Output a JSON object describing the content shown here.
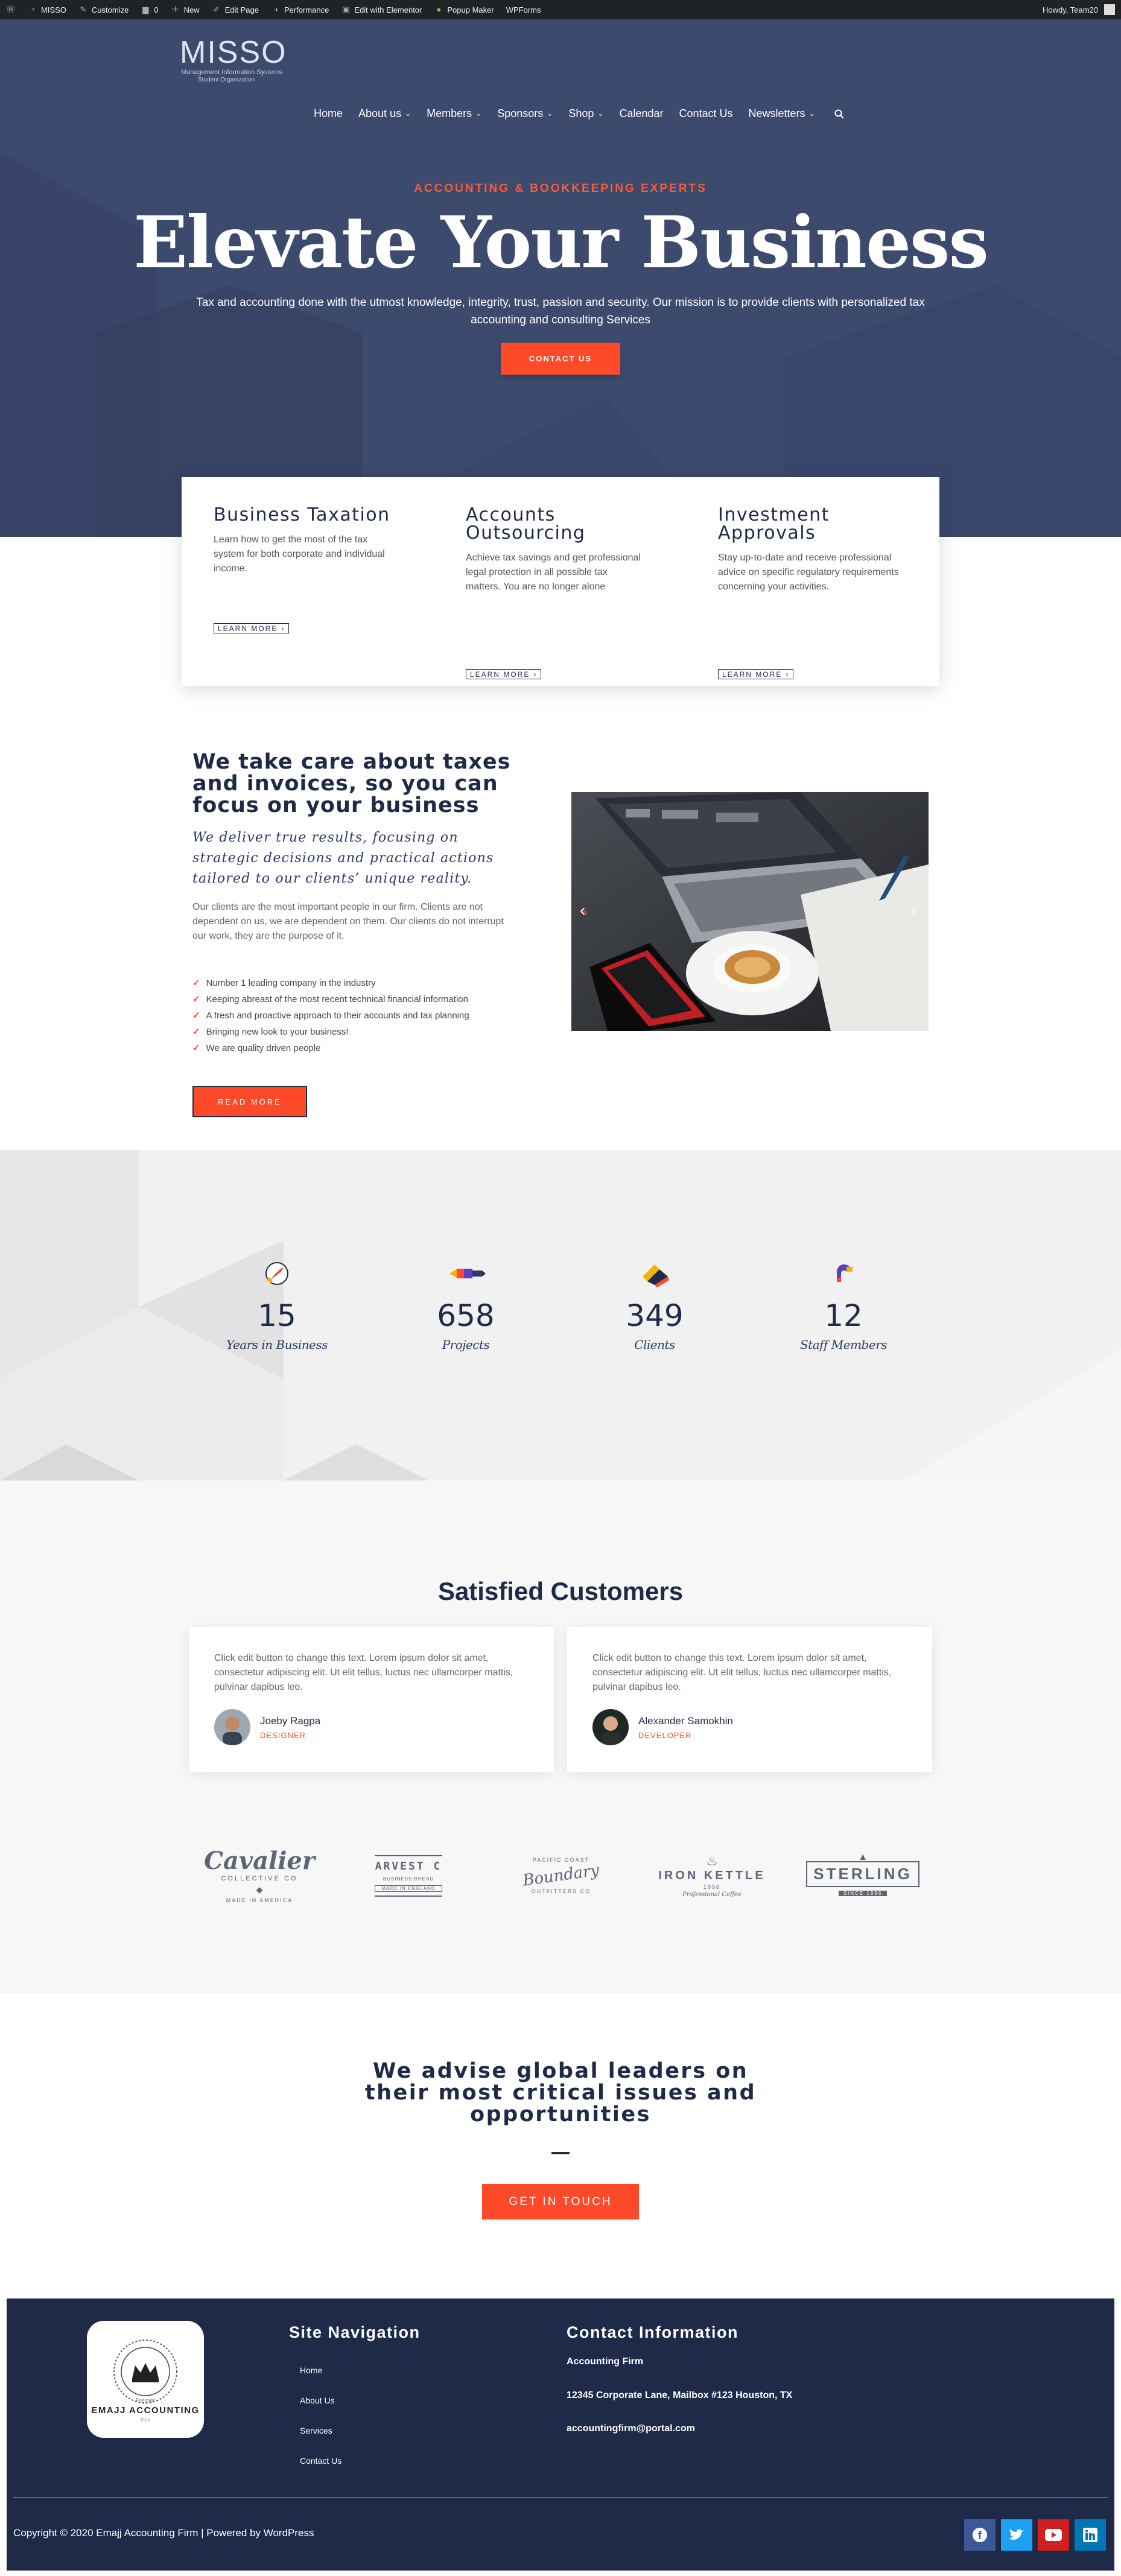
{
  "admin_bar": {
    "items": [
      "MISSO",
      "Customize",
      "0",
      "New",
      "Edit Page",
      "Performance",
      "Edit with Elementor",
      "Popup Maker",
      "WPForms"
    ],
    "howdy": "Howdy, Team20"
  },
  "site": {
    "logo_main": "MISSO",
    "logo_line1": "Management Information Systems",
    "logo_line2": "Student Organization"
  },
  "nav": {
    "items": [
      "Home",
      "About us",
      "Members",
      "Sponsors",
      "Shop",
      "Calendar",
      "Contact Us",
      "Newsletters"
    ]
  },
  "hero": {
    "kicker": "ACCOUNTING & BOOKKEEPING EXPERTS",
    "title": "Elevate Your Business",
    "subtitle": "Tax and accounting done with the utmost knowledge, integrity, trust, passion and security. Our mission is to provide clients with personalized tax accounting and consulting Services",
    "cta": "CONTACT US"
  },
  "services": [
    {
      "title": "Business Taxation",
      "text": "Learn how to get the most of the tax system for both corporate and individual income.",
      "link": "LEARN MORE"
    },
    {
      "title": "Accounts Outsourcing",
      "text": "Achieve tax savings and get professional legal protection in all possible tax matters. You are no longer alone",
      "link": "LEARN MORE"
    },
    {
      "title": "Investment Approvals",
      "text": "Stay up-to-date and receive professional advice on specific regulatory requirements concerning your activities.",
      "link": "LEARN MORE"
    }
  ],
  "about": {
    "heading": "We take care about taxes and invoices, so you can focus on your business",
    "quote": "We deliver true results, focusing on strategic decisions and practical actions tailored to our clients’ unique reality.",
    "paragraph": "Our clients are the most important people in our firm. Clients are not dependent on us, we are dependent on them. Our clients do not interrupt our work, they are the purpose of it.",
    "list": [
      "Number 1 leading company in the industry",
      "Keeping abreast of the most recent technical financial information",
      "A fresh and proactive approach to their accounts and tax planning",
      "Bringing new look to your business!",
      "We are quality driven people"
    ],
    "button": "READ MORE"
  },
  "stats": [
    {
      "value": "15",
      "label": "Years in Business",
      "icon": "compass-icon"
    },
    {
      "value": "658",
      "label": "Projects",
      "icon": "pencil-icon"
    },
    {
      "value": "349",
      "label": "Clients",
      "icon": "ruler-icon"
    },
    {
      "value": "12",
      "label": "Staff Members",
      "icon": "magnet-icon"
    }
  ],
  "testimonials": {
    "title": "Satisfied Customers",
    "items": [
      {
        "text": "Click edit button to change this text. Lorem ipsum dolor sit amet, consectetur adipiscing elit. Ut elit tellus, luctus nec ullamcorper mattis, pulvinar dapibus leo.",
        "name": "Joeby Ragpa",
        "role": "DESIGNER"
      },
      {
        "text": "Click edit button to change this text. Lorem ipsum dolor sit amet, consectetur adipiscing elit. Ut elit tellus, luctus nec ullamcorper mattis, pulvinar dapibus leo.",
        "name": "Alexander Samokhin",
        "role": "DEVELOPER"
      }
    ]
  },
  "brands": {
    "cavalier": {
      "name": "Cavalier",
      "sub": "COLLECTIVE CO",
      "foot": "MADE IN AMERICA"
    },
    "harvest": {
      "name": "ARVEST C",
      "sub": "BUSINESS BREAD",
      "foot": "MADE IN ENGLAND"
    },
    "boundary": {
      "name": "Boundary",
      "top": "PACIFIC COAST",
      "foot": "OUTFITTERS CO"
    },
    "iron_kettle": {
      "name": "IRON KETTLE",
      "sub": "1996",
      "foot": "Professional Coffee"
    },
    "sterling": {
      "name": "STERLING",
      "sub": "SINCE 1996"
    }
  },
  "cta": {
    "heading": "We advise global leaders on their most critical issues and opportunities",
    "button": "GET IN TOUCH"
  },
  "footer": {
    "logo_name": "EMAJJ ACCOUNTING",
    "logo_top": "Premier",
    "logo_bottom": "Firm",
    "nav_heading": "Site Navigation",
    "nav_links": [
      "Home",
      "About Us",
      "Services",
      "Contact Us"
    ],
    "contact_heading": "Contact Information",
    "contact_lines": [
      "Accounting Firm",
      "12345 Corporate Lane, Mailbox #123 Houston, TX",
      "accountingfirm@portal.com"
    ],
    "copyright": "Copyright © 2020 Emajj Accounting Firm | Powered by WordPress",
    "social": [
      "facebook-icon",
      "twitter-icon",
      "youtube-icon",
      "linkedin-icon"
    ]
  },
  "colors": {
    "navy": "#1f2a48",
    "hero_bg": "#3c4a6e",
    "accent": "#ff4a2a"
  }
}
